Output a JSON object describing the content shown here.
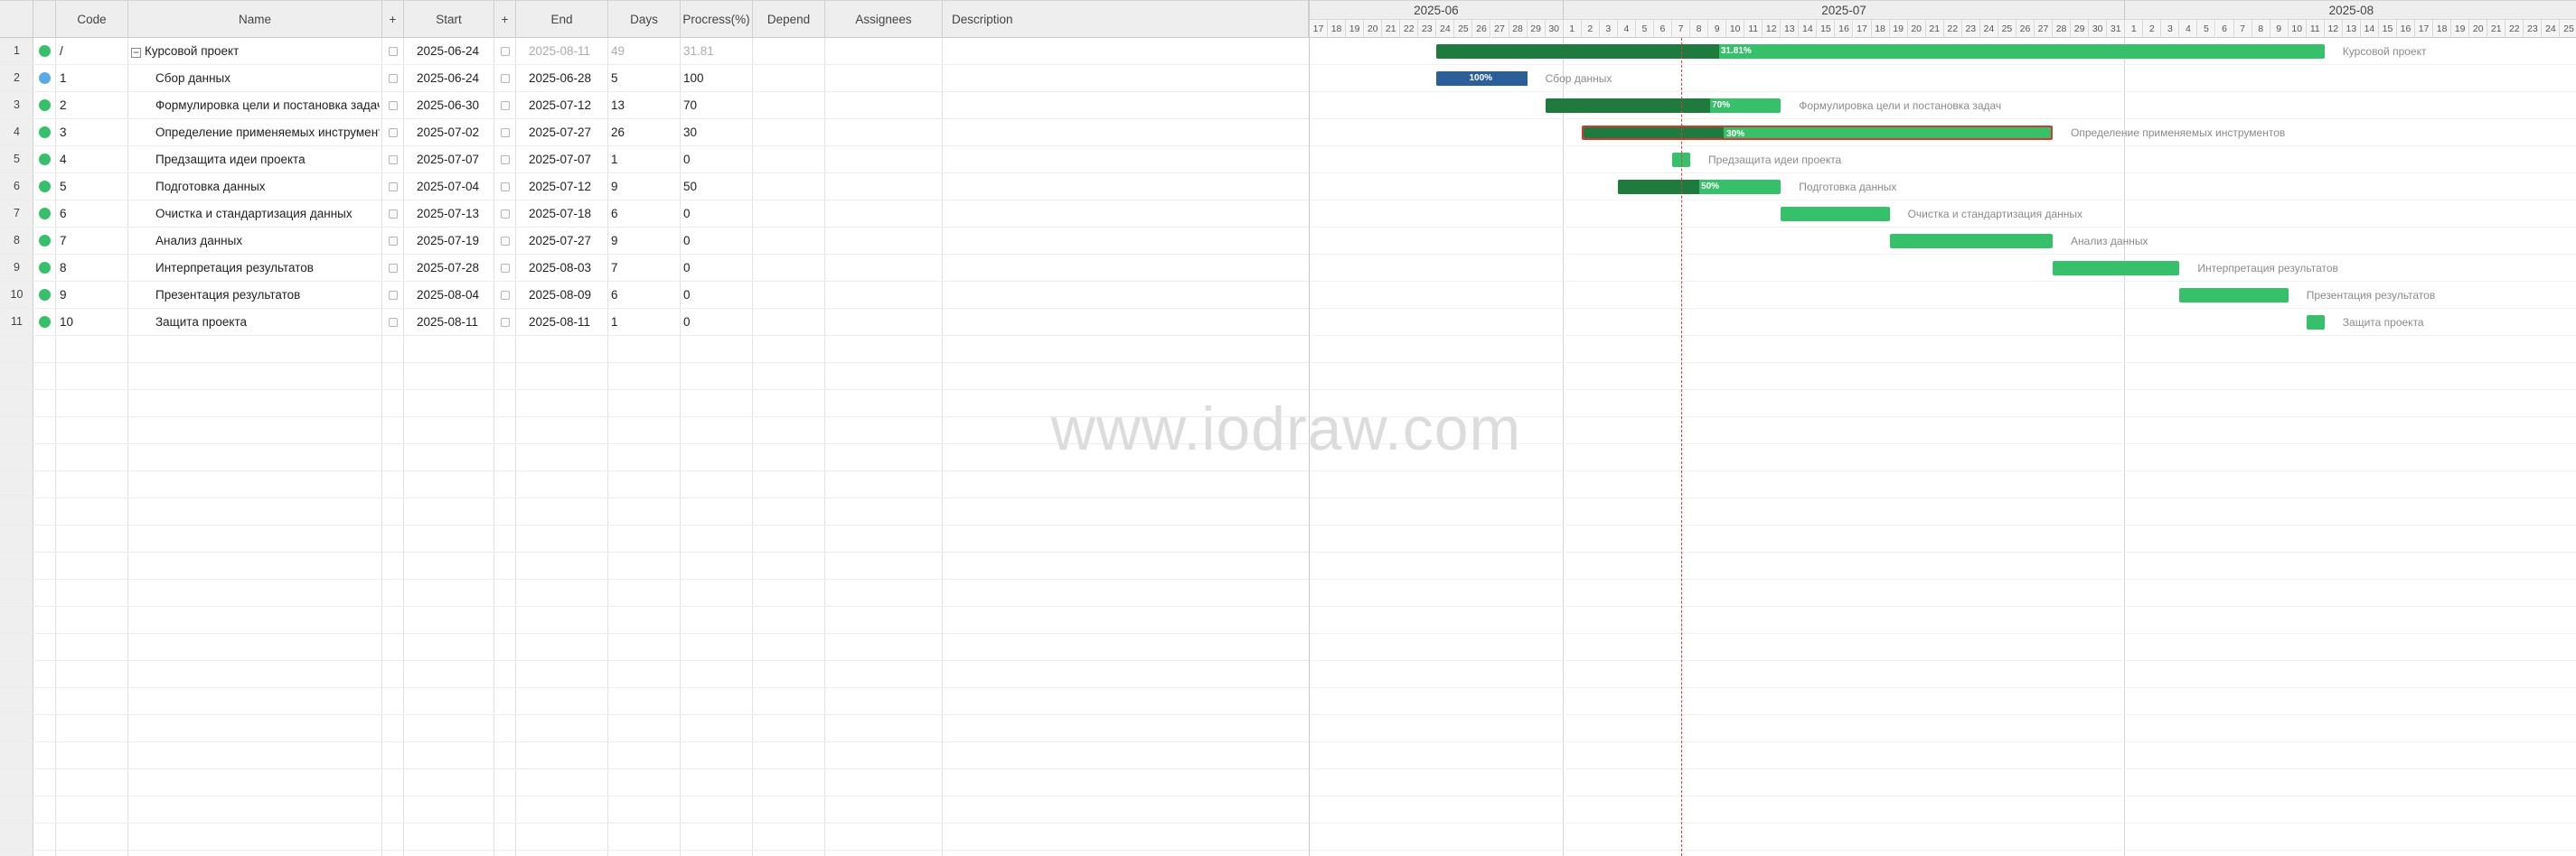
{
  "columns": {
    "code": "Code",
    "name": "Name",
    "plus1": "+",
    "start": "Start",
    "plus2": "+",
    "end": "End",
    "days": "Days",
    "progress": "Procress(%)",
    "depend": "Depend",
    "assignees": "Assignees",
    "description": "Description"
  },
  "rows": [
    {
      "num": "1",
      "code": "/",
      "name": "Курсовой проект",
      "start": "2025-06-24",
      "end": "2025-08-11",
      "days": "49",
      "progress": "31.81",
      "status_color": "#37c06a",
      "summary": true,
      "indent": false
    },
    {
      "num": "2",
      "code": "1",
      "name": "Сбор данных",
      "start": "2025-06-24",
      "end": "2025-06-28",
      "days": "5",
      "progress": "100",
      "status_color": "#5aa9e6",
      "summary": false,
      "indent": true
    },
    {
      "num": "3",
      "code": "2",
      "name": "Формулировка цели и постановка задач",
      "start": "2025-06-30",
      "end": "2025-07-12",
      "days": "13",
      "progress": "70",
      "status_color": "#37c06a",
      "summary": false,
      "indent": true
    },
    {
      "num": "4",
      "code": "3",
      "name": "Определение применяемых инструментов",
      "start": "2025-07-02",
      "end": "2025-07-27",
      "days": "26",
      "progress": "30",
      "status_color": "#37c06a",
      "summary": false,
      "indent": true
    },
    {
      "num": "5",
      "code": "4",
      "name": "Предзащита идеи проекта",
      "start": "2025-07-07",
      "end": "2025-07-07",
      "days": "1",
      "progress": "0",
      "status_color": "#37c06a",
      "summary": false,
      "indent": true
    },
    {
      "num": "6",
      "code": "5",
      "name": "Подготовка данных",
      "start": "2025-07-04",
      "end": "2025-07-12",
      "days": "9",
      "progress": "50",
      "status_color": "#37c06a",
      "summary": false,
      "indent": true
    },
    {
      "num": "7",
      "code": "6",
      "name": "Очистка и стандартизация данных",
      "start": "2025-07-13",
      "end": "2025-07-18",
      "days": "6",
      "progress": "0",
      "status_color": "#37c06a",
      "summary": false,
      "indent": true
    },
    {
      "num": "8",
      "code": "7",
      "name": "Анализ данных",
      "start": "2025-07-19",
      "end": "2025-07-27",
      "days": "9",
      "progress": "0",
      "status_color": "#37c06a",
      "summary": false,
      "indent": true
    },
    {
      "num": "9",
      "code": "8",
      "name": "Интерпретация результатов",
      "start": "2025-07-28",
      "end": "2025-08-03",
      "days": "7",
      "progress": "0",
      "status_color": "#37c06a",
      "summary": false,
      "indent": true
    },
    {
      "num": "10",
      "code": "9",
      "name": "Презентация результатов",
      "start": "2025-08-04",
      "end": "2025-08-09",
      "days": "6",
      "progress": "0",
      "status_color": "#37c06a",
      "summary": false,
      "indent": true
    },
    {
      "num": "11",
      "code": "10",
      "name": "Защита проекта",
      "start": "2025-08-11",
      "end": "2025-08-11",
      "days": "1",
      "progress": "0",
      "status_color": "#37c06a",
      "summary": false,
      "indent": true
    }
  ],
  "timeline": {
    "months": [
      "2025-06",
      "2025-07",
      "2025-08"
    ],
    "first_day": "2025-06-17",
    "last_day": "2025-08-25",
    "today": "2025-07-07",
    "selected_task": "3"
  },
  "bars": [
    {
      "label": "Курсовой проект",
      "progress_label": "31.81%",
      "start": "2025-06-24",
      "end": "2025-08-11",
      "progress": 31.81,
      "color": "#37c06a"
    },
    {
      "label": "Сбор данных",
      "progress_label": "100%",
      "start": "2025-06-24",
      "end": "2025-06-28",
      "progress": 100,
      "color": "#4b93cf"
    },
    {
      "label": "Формулировка цели и постановка задач",
      "progress_label": "70%",
      "start": "2025-06-30",
      "end": "2025-07-12",
      "progress": 70,
      "color": "#37c06a"
    },
    {
      "label": "Определение применяемых инструментов",
      "progress_label": "30%",
      "start": "2025-07-02",
      "end": "2025-07-27",
      "progress": 30,
      "color": "#37c06a"
    },
    {
      "label": "Предзащита идеи проекта",
      "progress_label": "",
      "start": "2025-07-07",
      "end": "2025-07-07",
      "progress": 0,
      "color": "#37c06a"
    },
    {
      "label": "Подготовка данных",
      "progress_label": "50%",
      "start": "2025-07-04",
      "end": "2025-07-12",
      "progress": 50,
      "color": "#37c06a"
    },
    {
      "label": "Очистка и стандартизация данных",
      "progress_label": "",
      "start": "2025-07-13",
      "end": "2025-07-18",
      "progress": 0,
      "color": "#37c06a"
    },
    {
      "label": "Анализ данных",
      "progress_label": "",
      "start": "2025-07-19",
      "end": "2025-07-27",
      "progress": 0,
      "color": "#37c06a"
    },
    {
      "label": "Интерпретация результатов",
      "progress_label": "",
      "start": "2025-07-28",
      "end": "2025-08-03",
      "progress": 0,
      "color": "#37c06a"
    },
    {
      "label": "Презентация результатов",
      "progress_label": "",
      "start": "2025-08-04",
      "end": "2025-08-09",
      "progress": 0,
      "color": "#37c06a"
    },
    {
      "label": "Защита проекта",
      "progress_label": "",
      "start": "2025-08-11",
      "end": "2025-08-11",
      "progress": 0,
      "color": "#37c06a"
    }
  ],
  "watermark": "www.iodraw.com",
  "colors": {
    "bar": "#37c06a",
    "progress": "#1f7a3e",
    "bar_done": "#4b93cf",
    "today_line": "#e23b3b",
    "selected_outline": "#d03a2f"
  }
}
